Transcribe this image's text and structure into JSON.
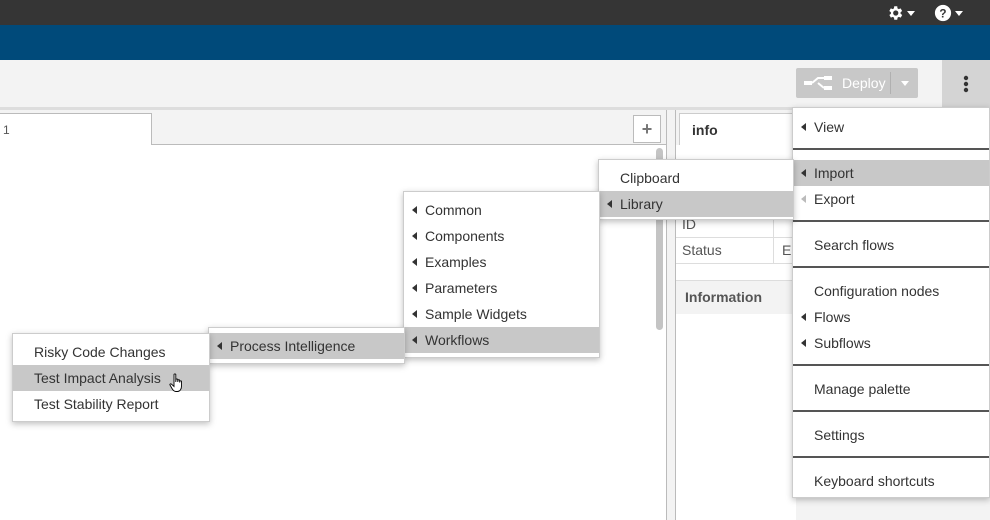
{
  "header": {
    "settings_icon": "gear-icon",
    "help_icon": "question-circle-icon",
    "colors": {
      "topbar": "#353535",
      "accent": "#004a7a"
    }
  },
  "toolbar": {
    "deploy_label": "Deploy",
    "menu_icon": "vertical-ellipsis-icon"
  },
  "workspace": {
    "tab_label": "1",
    "add_tab": "+"
  },
  "sidebar": {
    "tab_label": "info",
    "rows": [
      {
        "label": "ID",
        "value": ""
      },
      {
        "label": "Status",
        "value": "E"
      }
    ],
    "section_title": "Information"
  },
  "main_menu": {
    "items": [
      {
        "label": "View",
        "submenu": true
      },
      {
        "label": "Import",
        "submenu": true,
        "highlighted": true
      },
      {
        "label": "Export",
        "submenu": true
      },
      {
        "label": "Search flows"
      },
      {
        "label": "Configuration nodes"
      },
      {
        "label": "Flows",
        "submenu": true
      },
      {
        "label": "Subflows",
        "submenu": true
      },
      {
        "label": "Manage palette"
      },
      {
        "label": "Settings"
      },
      {
        "label": "Keyboard shortcuts"
      }
    ]
  },
  "import_menu": {
    "items": [
      {
        "label": "Clipboard"
      },
      {
        "label": "Library",
        "submenu": true,
        "highlighted": true
      }
    ]
  },
  "library_menu": {
    "items": [
      {
        "label": "Common"
      },
      {
        "label": "Components"
      },
      {
        "label": "Examples"
      },
      {
        "label": "Parameters"
      },
      {
        "label": "Sample Widgets"
      },
      {
        "label": "Workflows",
        "highlighted": true
      }
    ]
  },
  "workflows_menu": {
    "items": [
      {
        "label": "Process Intelligence",
        "highlighted": true
      }
    ]
  },
  "process_menu": {
    "items": [
      {
        "label": "Risky Code Changes"
      },
      {
        "label": "Test Impact Analysis",
        "highlighted": true
      },
      {
        "label": "Test Stability Report"
      }
    ]
  }
}
